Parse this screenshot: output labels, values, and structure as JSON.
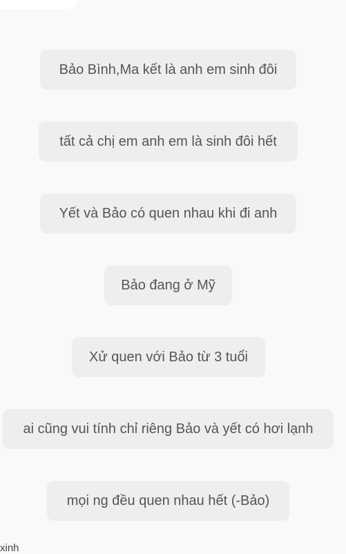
{
  "messages": [
    "Bảo Bình,Ma kết là anh em sinh đôi",
    "tất cả chị em anh em là sinh đôi hết",
    "Yết và Bảo có quen nhau khi đi anh",
    "Bảo đang ở Mỹ",
    "Xử quen với Bảo từ 3 tuổi",
    "ai cũng vui tính chỉ riêng Bảo và yết có hơi lạnh",
    "mọi ng đều quen nhau hết (-Bảo)"
  ],
  "footer": {
    "label": "xinh"
  },
  "colors": {
    "background": "#f8f9fa",
    "chip_background": "#eeeeee",
    "chip_text": "#555555"
  }
}
